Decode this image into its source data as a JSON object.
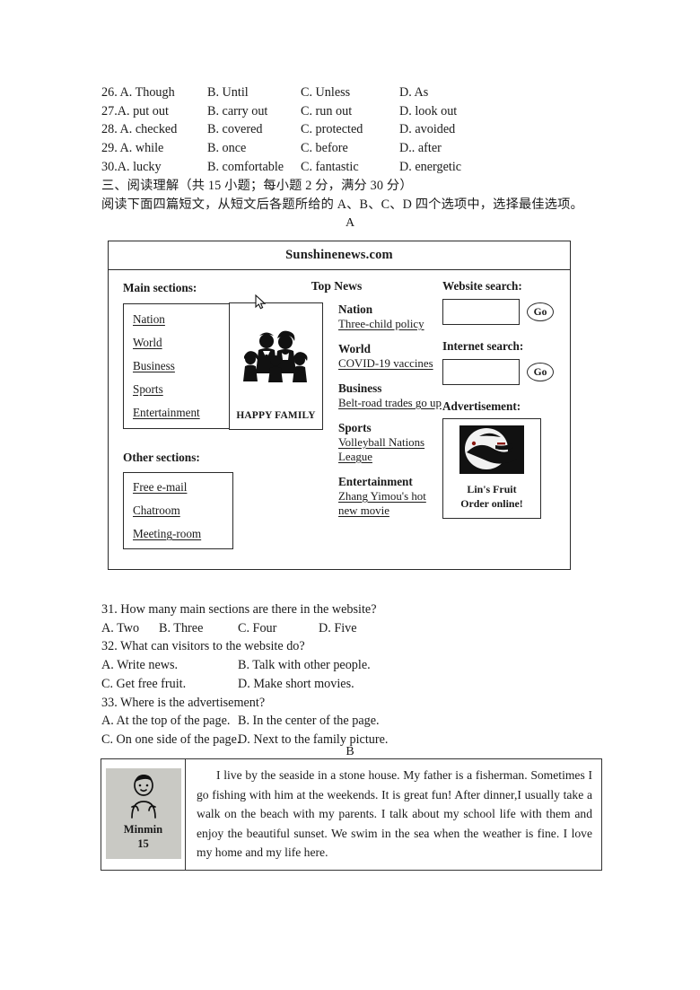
{
  "cloze": {
    "rows": [
      {
        "a": "26. A. Though",
        "b": "B. Until",
        "c": "C. Unless",
        "d": "D. As"
      },
      {
        "a": "27.A. put out",
        "b": "B. carry out",
        "c": "C. run out",
        "d": "D. look out"
      },
      {
        "a": "28. A. checked",
        "b": "B. covered",
        "c": "C. protected",
        "d": "D. avoided"
      },
      {
        "a": "29. A. while",
        "b": "B. once",
        "c": "C. before",
        "d": "D.. after"
      },
      {
        "a": "30.A. lucky",
        "b": "B. comfortable",
        "c": "C. fantastic",
        "d": "D. energetic"
      }
    ]
  },
  "section": {
    "heading": "三、阅读理解（共 15 小题；每小题 2 分，满分 30 分）",
    "instruction": "阅读下面四篇短文，从短文后各题所给的 A、B、C、D 四个选项中，选择最佳选项。",
    "label_a": "A",
    "label_b": "B"
  },
  "website": {
    "title": "Sunshinenews.com",
    "main_sections_label": "Main sections:",
    "main_sections": [
      "Nation",
      "World",
      "Business",
      "Sports",
      "Entertainment"
    ],
    "other_sections_label": "Other sections:",
    "other_sections": [
      "Free e-mail",
      "Chatroom",
      "Meeting-room"
    ],
    "top_news_label": "Top News",
    "news": [
      {
        "category": "Nation",
        "headline": "Three-child policy"
      },
      {
        "category": "World",
        "headline": "COVID-19 vaccines"
      },
      {
        "category": "Business",
        "headline": "Belt-road trades go up"
      },
      {
        "category": "Sports",
        "headline": "Volleyball Nations League"
      },
      {
        "category": "Entertainment",
        "headline": "Zhang Yimou's hot new movie"
      }
    ],
    "family_picture_caption": "HAPPY FAMILY",
    "website_search_label": "Website search:",
    "website_search_value": "",
    "internet_search_label": "Internet search:",
    "internet_search_value": "",
    "go_label": "Go",
    "advertisement_label": "Advertisement:",
    "ad_line1": "Lin's Fruit",
    "ad_line2": "Order online!"
  },
  "questions": [
    {
      "stem": "31. How many main sections are there in the website?",
      "opts": [
        "A. Two",
        "B. Three",
        "C. Four",
        "D. Five"
      ],
      "layout": "narrow"
    },
    {
      "stem": "32. What can visitors to the website do?",
      "opts": [
        "A. Write news.",
        "B. Talk with other people.",
        "C. Get free fruit.",
        "D. Make short movies."
      ],
      "layout": "wide"
    },
    {
      "stem": "33. Where is the advertisement?",
      "opts": [
        "A. At the top of the page.",
        "B. In the center of the page.",
        "C. On one side of the page.",
        "D. Next to the family picture."
      ],
      "layout": "wide"
    }
  ],
  "passage_b": {
    "avatar_name": "Minmin",
    "avatar_age": "15",
    "text": "I live by the seaside in a stone house. My father is a fisherman. Sometimes I go fishing with him at the weekends. It is great fun! After dinner,I usually take a walk on the beach with my parents. I talk about my school life with them and enjoy the beautiful sunset. We swim in the sea when the weather is fine. I love my home and my life here."
  },
  "colors": {
    "ink": "#1a1a1a",
    "rule": "#2a2a2a",
    "avatar_bg": "#c9c9c4"
  }
}
